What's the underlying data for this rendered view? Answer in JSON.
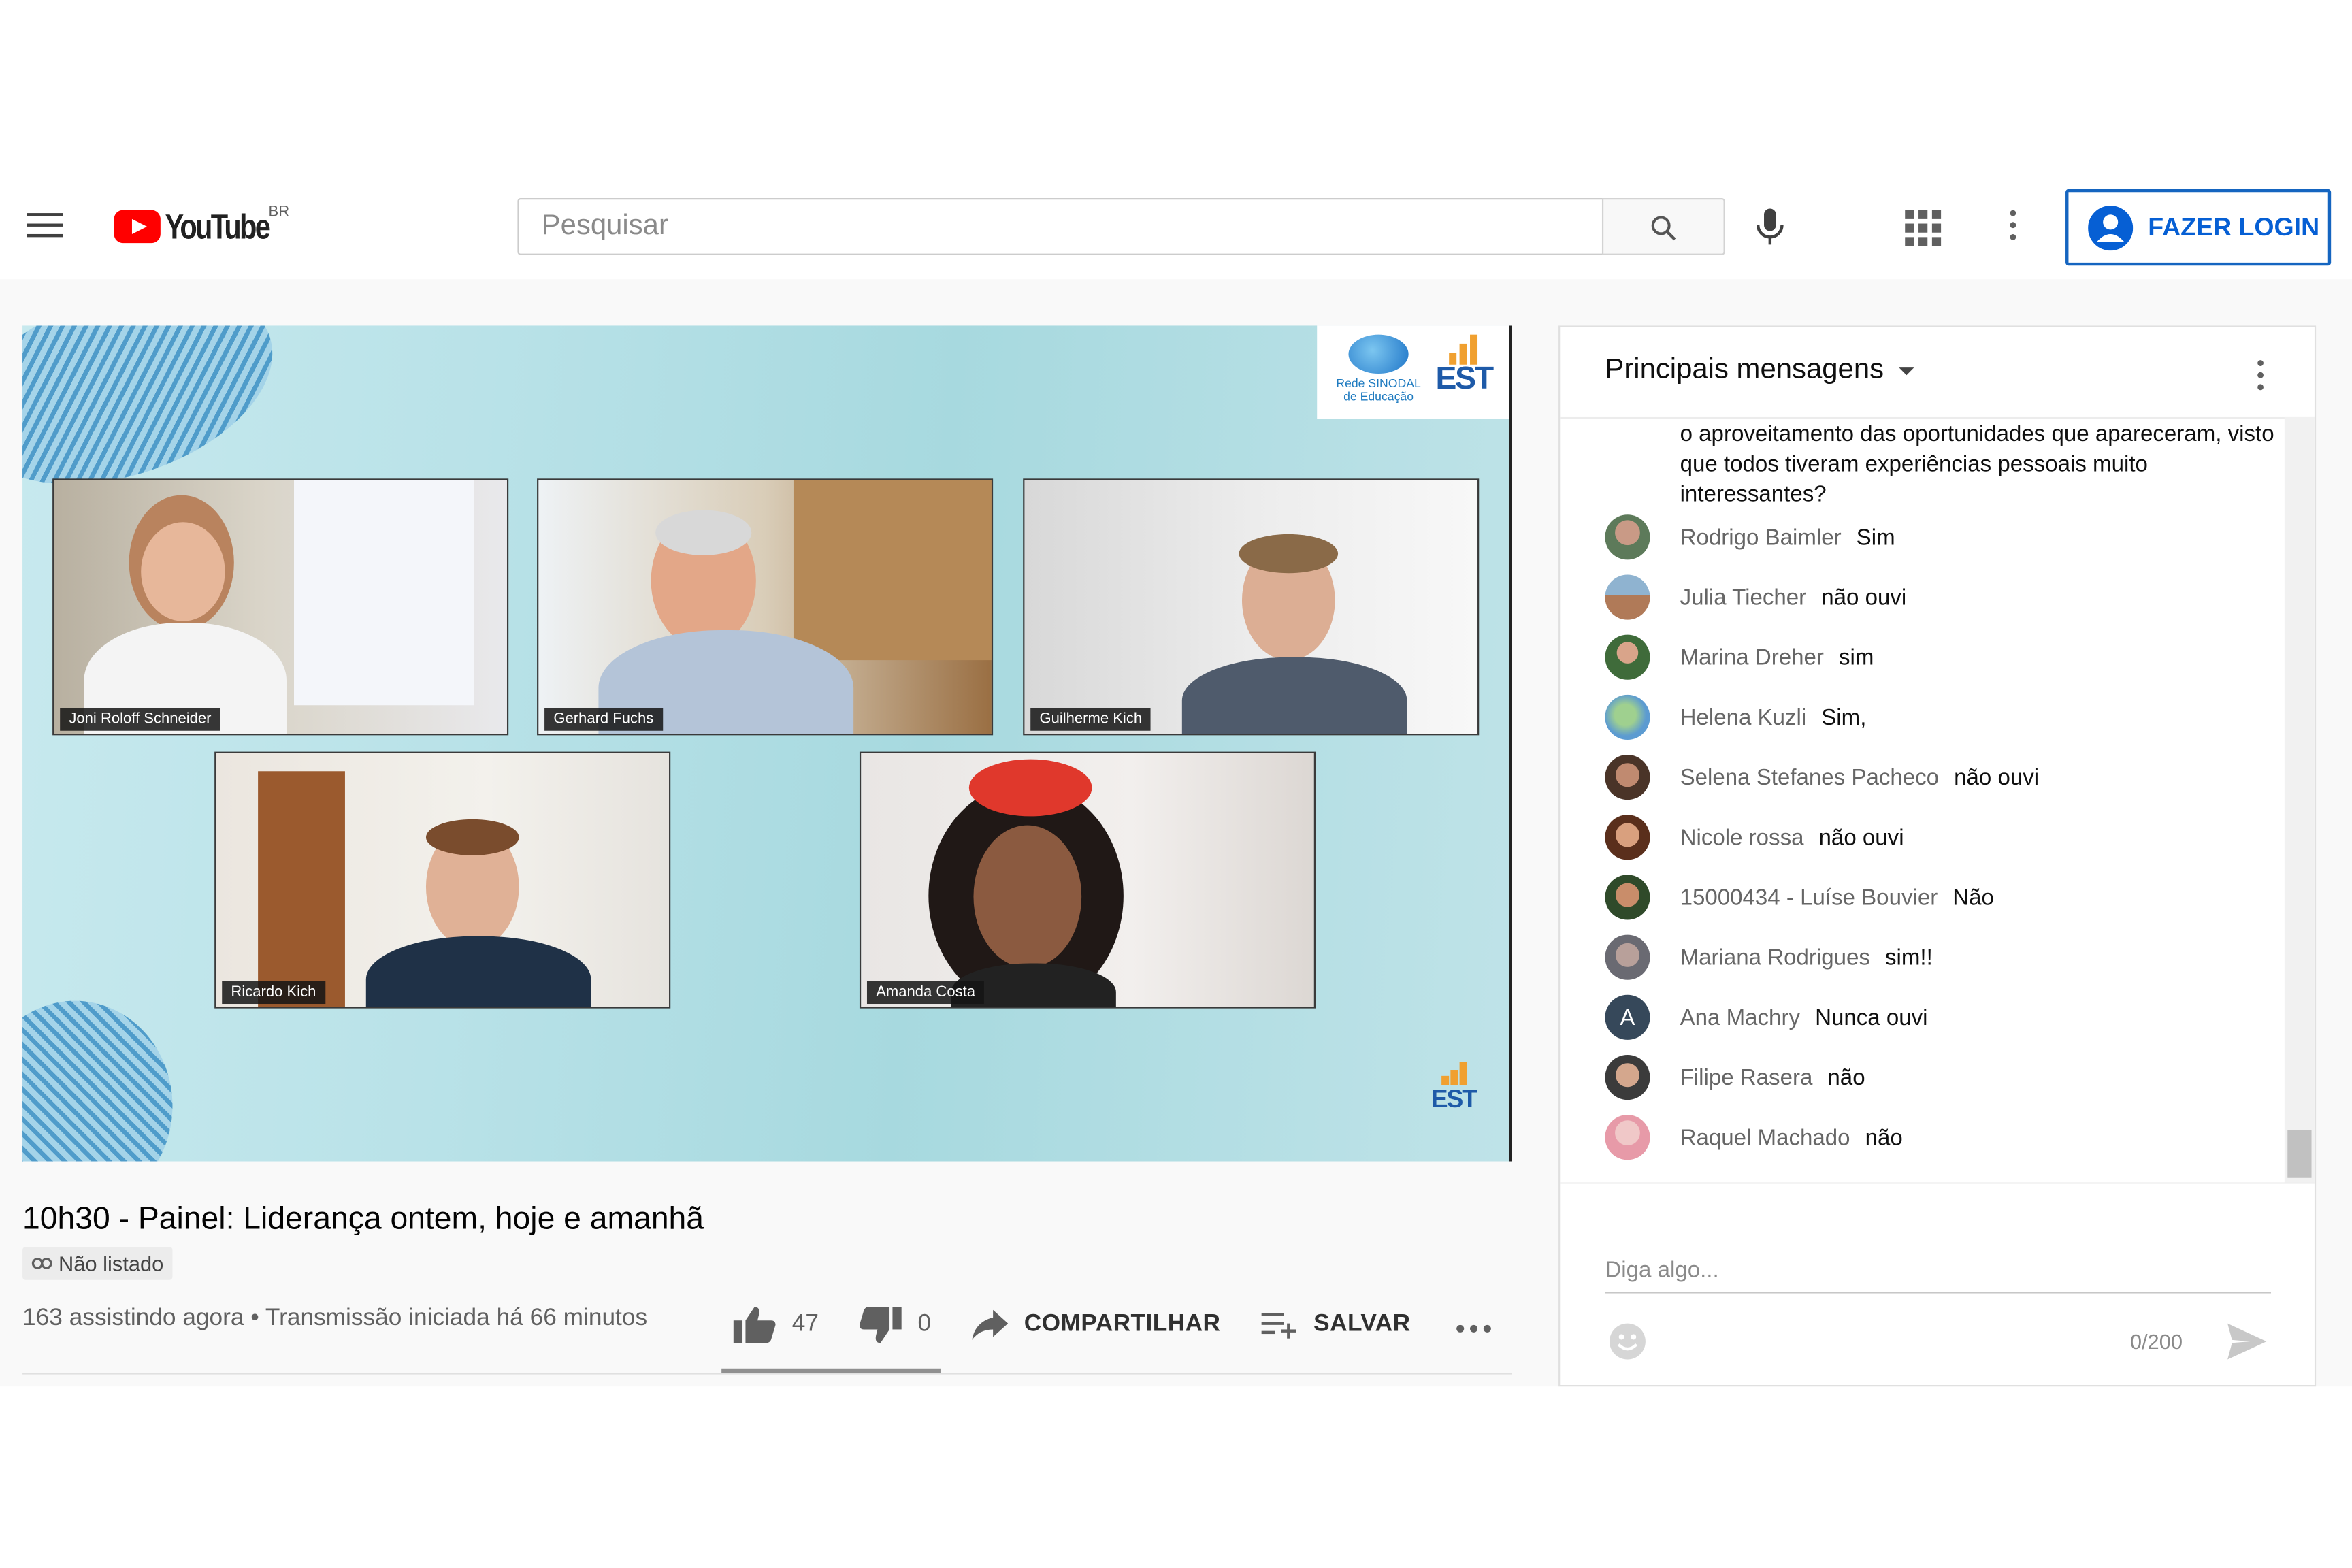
{
  "masthead": {
    "logo_text": "YouTube",
    "country_code": "BR",
    "search_placeholder": "Pesquisar",
    "login_label": "FAZER LOGIN",
    "icons": [
      "menu-icon",
      "search-icon",
      "mic-icon",
      "apps-grid-icon",
      "more-vert-icon",
      "account-circle-icon"
    ]
  },
  "player": {
    "participants": [
      "Joni Roloff Schneider",
      "Gerhard Fuchs",
      "Guilherme Kich",
      "Ricardo Kich",
      "Amanda Costa"
    ],
    "logo_rede_line1": "Rede SINODAL",
    "logo_rede_line2": "de Educação",
    "logo_est": "EST"
  },
  "video": {
    "title": "10h30 - Painel: Liderança ontem, hoje e amanhã",
    "badge": "Não listado",
    "watching": "163 assistindo agora",
    "separator": "•",
    "started": "Transmissão iniciada há 66 minutos",
    "likes": "47",
    "dislikes": "0",
    "share_label": "COMPARTILHAR",
    "save_label": "SALVAR"
  },
  "chat": {
    "mode_label": "Principais mensagens",
    "partial_text": "o aproveitamento das oportunidades que apareceram, visto que todos tiveram experiências pessoais muito interessantes?",
    "messages": [
      {
        "author": "Rodrigo Baimler",
        "text": "Sim"
      },
      {
        "author": "Julia Tiecher",
        "text": "não ouvi"
      },
      {
        "author": "Marina Dreher",
        "text": "sim"
      },
      {
        "author": "Helena Kuzli",
        "text": "Sim,"
      },
      {
        "author": "Selena Stefanes Pacheco",
        "text": "não ouvi"
      },
      {
        "author": "Nicole rossa",
        "text": "não ouvi"
      },
      {
        "author": "15000434 - Luíse Bouvier",
        "text": "Não"
      },
      {
        "author": "Mariana Rodrigues",
        "text": "sim!!"
      },
      {
        "author": "Ana Machry",
        "text": "Nunca ouvi",
        "avatar_letter": "A"
      },
      {
        "author": "Filipe Rasera",
        "text": "não"
      },
      {
        "author": "Raquel Machado",
        "text": "não"
      }
    ],
    "input_placeholder": "Diga algo...",
    "char_count": "0/200"
  },
  "colors": {
    "brand_red": "#ff0000",
    "login_blue": "#065fd4",
    "player_bg": "#b9e2e8"
  }
}
